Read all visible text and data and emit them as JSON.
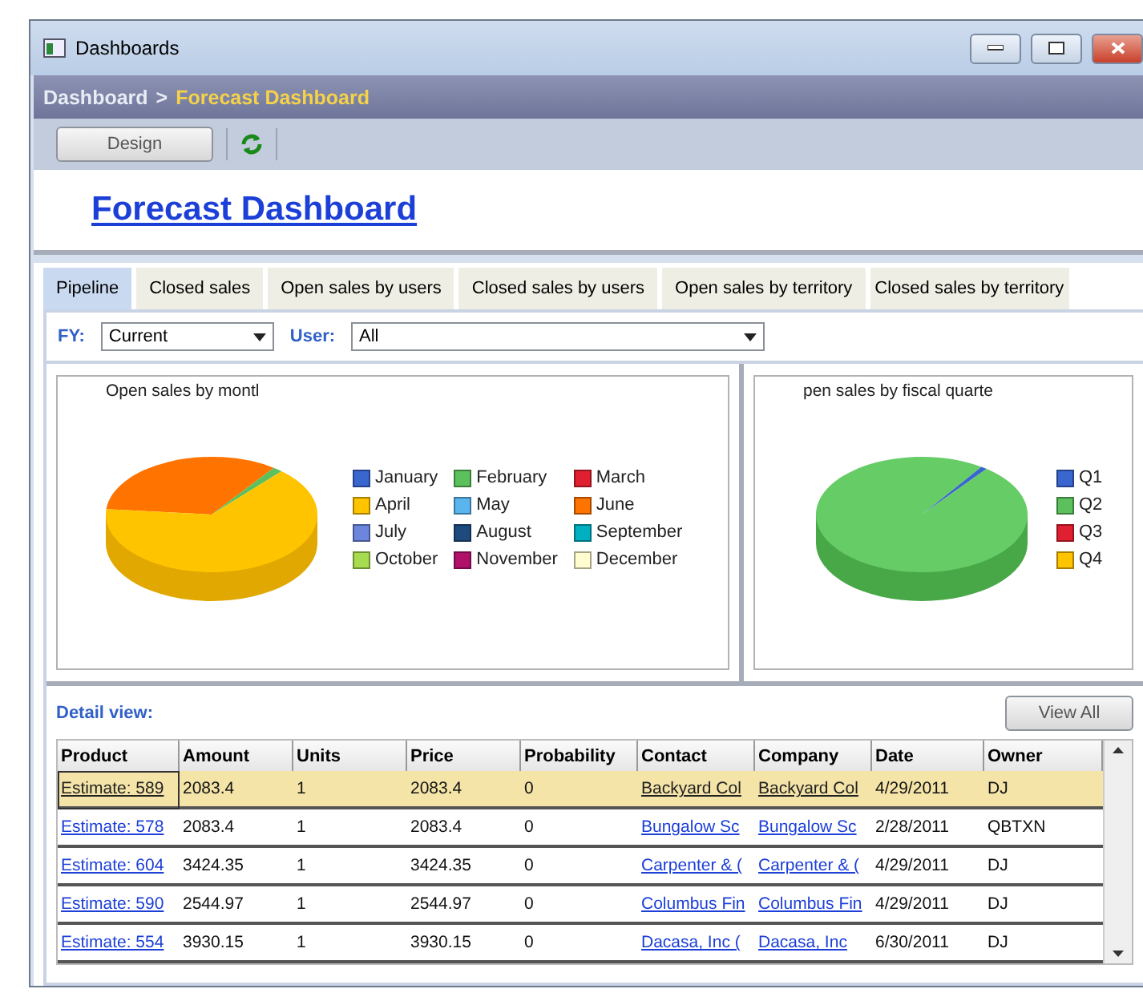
{
  "window": {
    "title": "Dashboards"
  },
  "breadcrumb": {
    "parent": "Dashboard",
    "separator": ">",
    "current": "Forecast Dashboard"
  },
  "toolbar": {
    "design_button": "Design"
  },
  "heading": "Forecast Dashboard",
  "tabs": [
    {
      "label": "Pipeline",
      "selected": true
    },
    {
      "label": "Closed sales",
      "selected": false
    },
    {
      "label": "Open sales by users",
      "selected": false
    },
    {
      "label": "Closed sales by users",
      "selected": false
    },
    {
      "label": "Open sales by territory",
      "selected": false
    },
    {
      "label": "Closed sales by territory",
      "selected": false
    }
  ],
  "filters": [
    {
      "label": "FY:",
      "value": "Current",
      "kind": "short"
    },
    {
      "label": "User:",
      "value": "All",
      "kind": "long"
    }
  ],
  "charts": [
    {
      "title": "Open sales by montl",
      "kind": "months",
      "legend": [
        {
          "label": "January",
          "color": "#3a66d0"
        },
        {
          "label": "February",
          "color": "#5cc05c"
        },
        {
          "label": "March",
          "color": "#e02030"
        },
        {
          "label": "April",
          "color": "#ffc400"
        },
        {
          "label": "May",
          "color": "#5ab4ee"
        },
        {
          "label": "June",
          "color": "#ff7300"
        },
        {
          "label": "July",
          "color": "#6c86de"
        },
        {
          "label": "August",
          "color": "#1e4a7e"
        },
        {
          "label": "September",
          "color": "#00b0c0"
        },
        {
          "label": "October",
          "color": "#a8dc50"
        },
        {
          "label": "November",
          "color": "#b0106a"
        },
        {
          "label": "December",
          "color": "#fffcd0"
        }
      ]
    },
    {
      "title": "pen sales by fiscal quarte",
      "kind": "quarters",
      "legend": [
        {
          "label": "Q1",
          "color": "#3a66d0"
        },
        {
          "label": "Q2",
          "color": "#5cc05c"
        },
        {
          "label": "Q3",
          "color": "#e02030"
        },
        {
          "label": "Q4",
          "color": "#ffc400"
        }
      ]
    }
  ],
  "detail": {
    "title": "Detail view:",
    "view_all_button": "View All",
    "columns": [
      {
        "label": "Product",
        "kind": "link"
      },
      {
        "label": "Amount",
        "kind": "text"
      },
      {
        "label": "Units",
        "kind": "text"
      },
      {
        "label": "Price",
        "kind": "text"
      },
      {
        "label": "Probability",
        "kind": "text"
      },
      {
        "label": "Contact",
        "kind": "link"
      },
      {
        "label": "Company",
        "kind": "link"
      },
      {
        "label": "Date",
        "kind": "text"
      },
      {
        "label": "Owner",
        "kind": "text"
      }
    ],
    "rows": [
      {
        "selected": true,
        "cells": [
          "Estimate: 589",
          "2083.4",
          "1",
          "2083.4",
          "0",
          "Backyard Col",
          "Backyard Col",
          "4/29/2011",
          "DJ"
        ]
      },
      {
        "selected": false,
        "cells": [
          "Estimate: 578",
          "2083.4",
          "1",
          "2083.4",
          "0",
          "Bungalow Sc",
          "Bungalow Sc",
          "2/28/2011",
          "QBTXN"
        ]
      },
      {
        "selected": false,
        "cells": [
          "Estimate: 604",
          "3424.35",
          "1",
          "3424.35",
          "0",
          "Carpenter & (",
          "Carpenter & (",
          "4/29/2011",
          "DJ"
        ]
      },
      {
        "selected": false,
        "cells": [
          "Estimate: 590",
          "2544.97",
          "1",
          "2544.97",
          "0",
          "Columbus Fin",
          "Columbus Fin",
          "4/29/2011",
          "DJ"
        ]
      },
      {
        "selected": false,
        "cells": [
          "Estimate: 554",
          "3930.15",
          "1",
          "3930.15",
          "0",
          "Dacasa, Inc (",
          "Dacasa, Inc",
          "6/30/2011",
          "DJ"
        ]
      }
    ]
  }
}
